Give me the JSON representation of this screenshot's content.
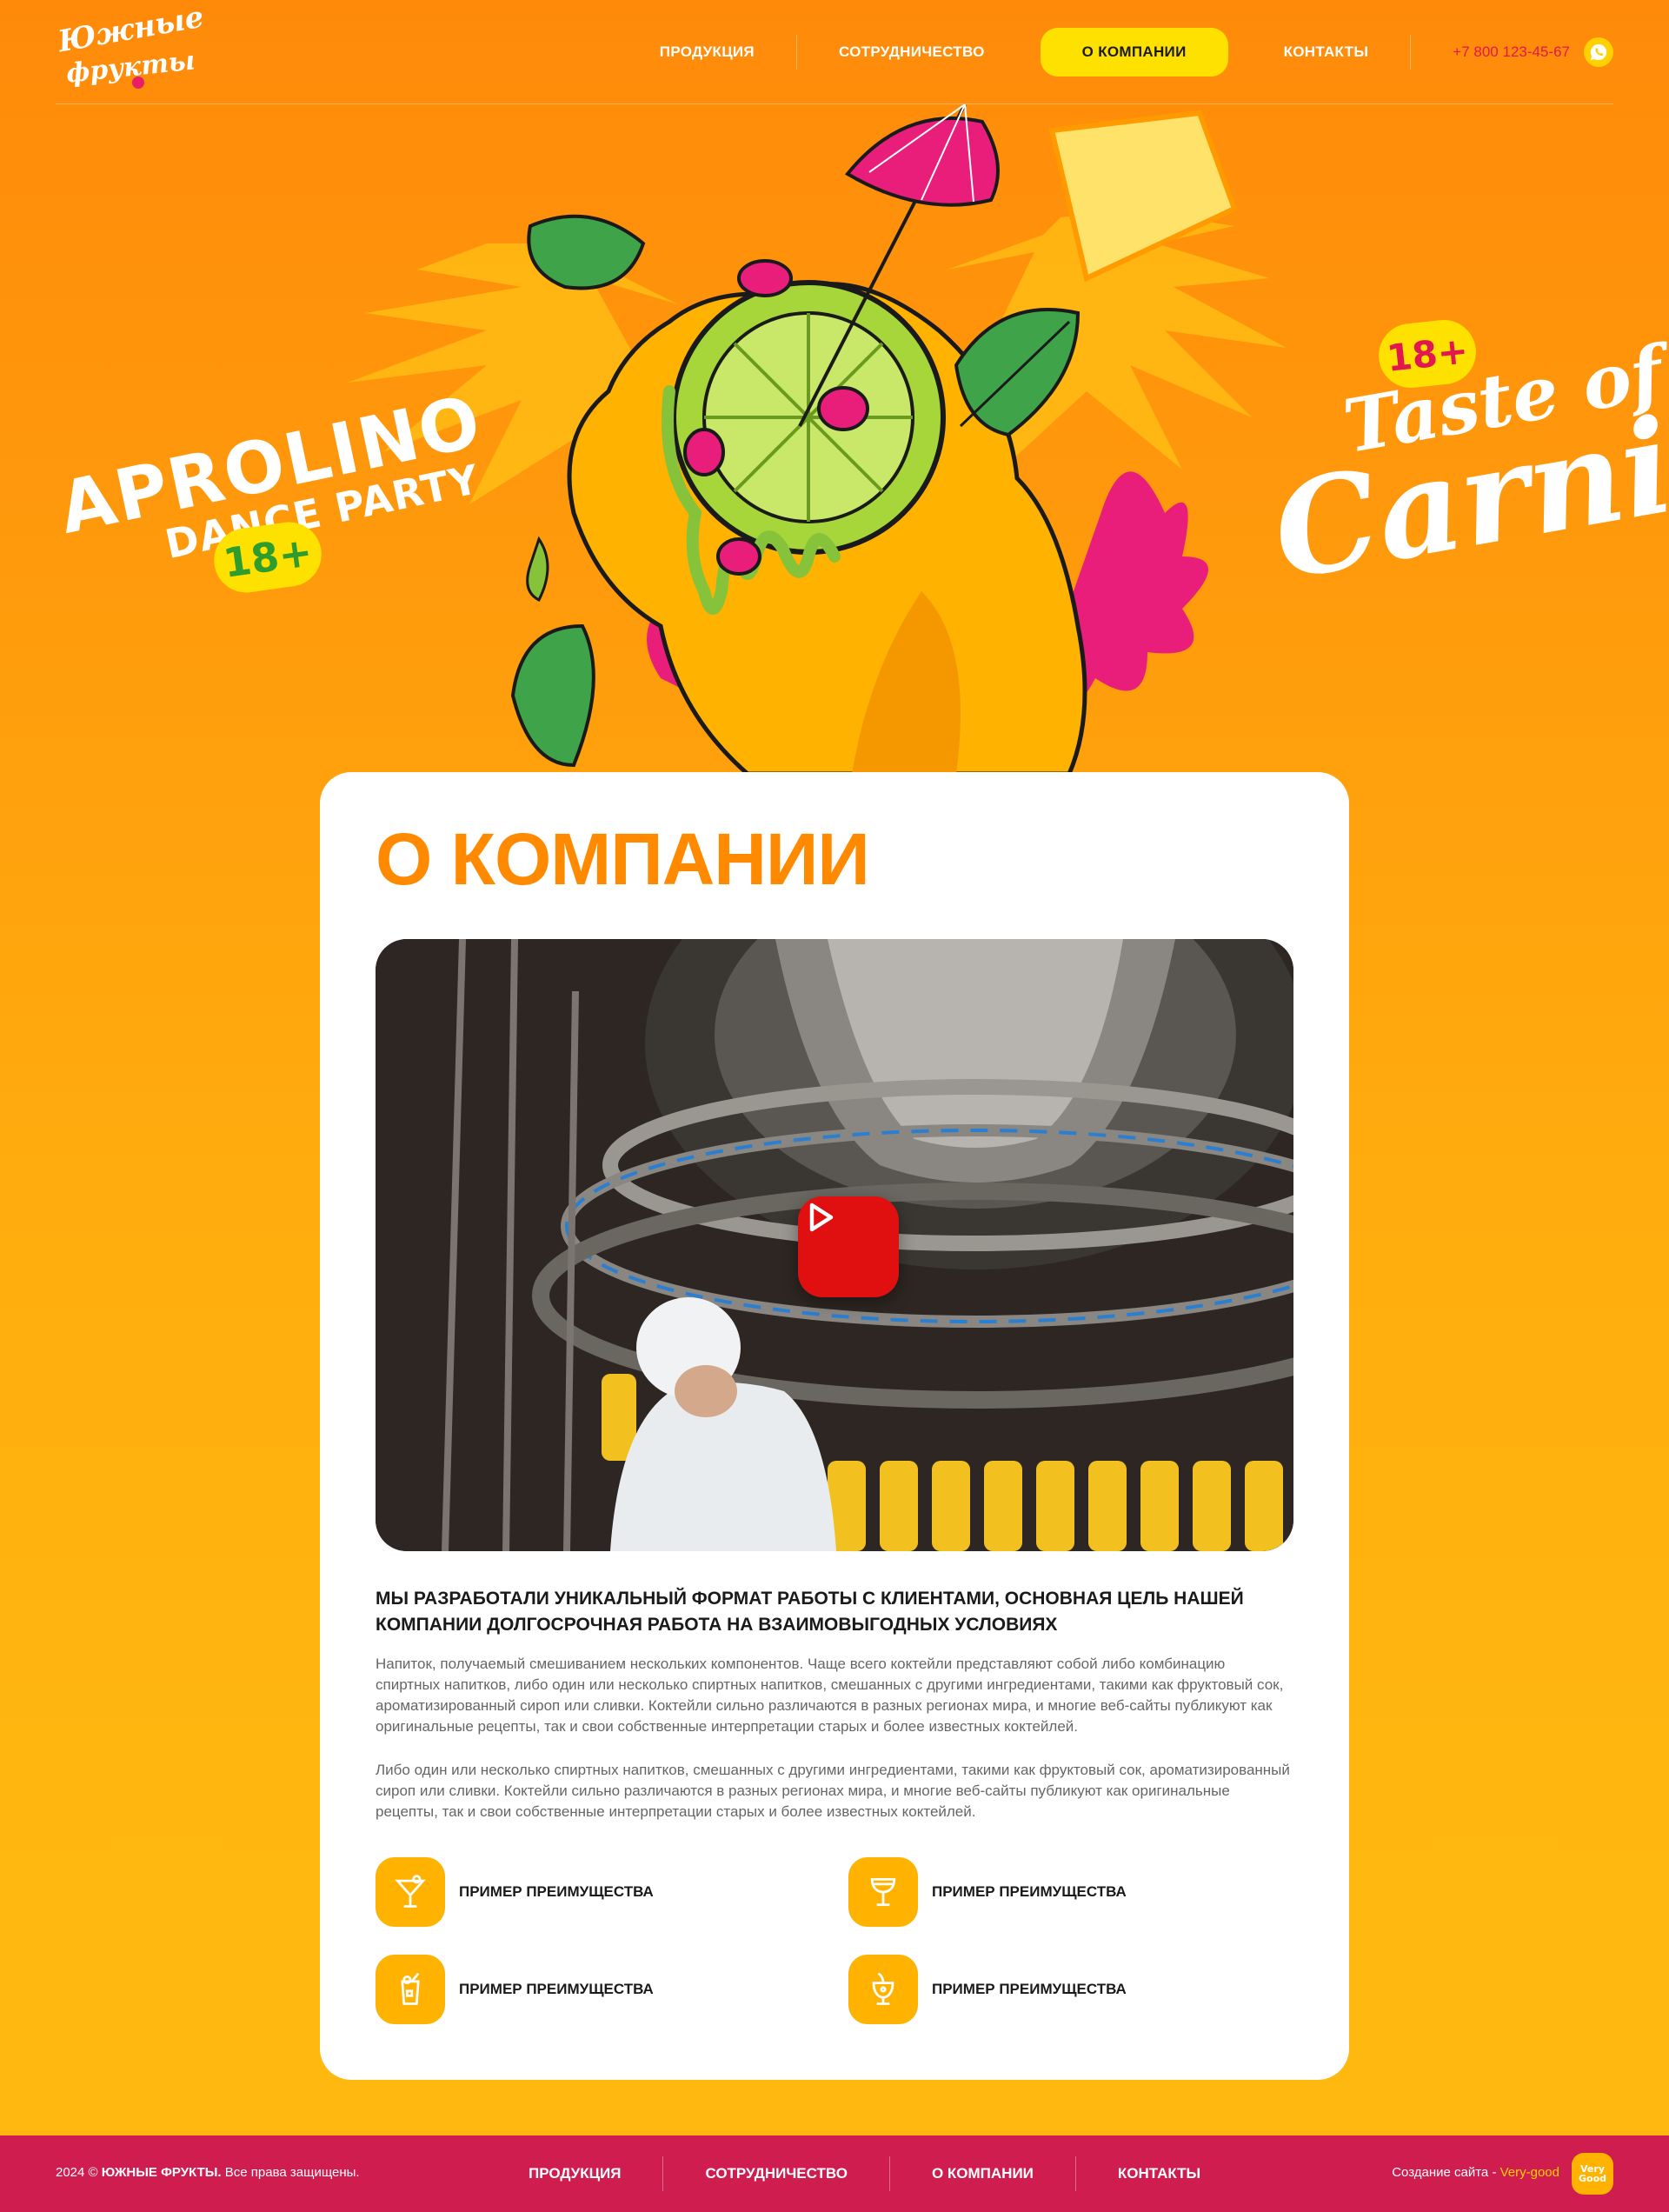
{
  "header": {
    "logo_line1": "Южные",
    "logo_line2": "фрукты",
    "nav": [
      "ПРОДУКЦИЯ",
      "СОТРУДНИЧЕСТВО",
      "О КОМПАНИИ",
      "КОНТАКТЫ"
    ],
    "active_nav": "О КОМПАНИИ",
    "phone": "+7 800 123-45-67",
    "whatsapp_icon": "whatsapp-icon"
  },
  "hero": {
    "left_title": "APROLINO",
    "left_subtitle": "DANCE PARTY",
    "left_badge": "18+",
    "right_badge": "18+",
    "right_line1": "Taste of",
    "right_line2": "Carnival"
  },
  "about": {
    "title": "О КОМПАНИИ",
    "video_play_icon": "play-icon",
    "lead": "МЫ РАЗРАБОТАЛИ УНИКАЛЬНЫЙ ФОРМАТ РАБОТЫ С КЛИЕНТАМИ, ОСНОВНАЯ ЦЕЛЬ НАШЕЙ КОМПАНИИ ДОЛГОСРОЧНАЯ РАБОТА НА ВЗАИМОВЫГОДНЫХ УСЛОВИЯХ",
    "paragraph1": "Напиток, получаемый смешиванием нескольких компонентов. Чаще всего коктейли представляют собой либо комбинацию спиртных напитков, либо один или несколько спиртных напитков, смешанных с другими ингредиентами, такими как фруктовый сок, ароматизированный сироп или сливки. Коктейли сильно различаются в разных регионах мира, и многие веб-сайты публикуют как оригинальные рецепты, так и свои собственные интерпретации старых и более известных коктейлей.",
    "paragraph2": "Либо один или несколько спиртных напитков, смешанных с другими ингредиентами, такими как фруктовый сок, ароматизированный сироп или сливки. Коктейли сильно различаются в разных регионах мира, и многие веб-сайты публикуют как оригинальные рецепты, так и свои собственные интерпретации старых и более известных коктейлей.",
    "features": [
      {
        "label": "ПРИМЕР ПРЕИМУЩЕСТВА",
        "icon": "martini-icon"
      },
      {
        "label": "ПРИМЕР ПРЕИМУЩЕСТВА",
        "icon": "coupe-glass-icon"
      },
      {
        "label": "ПРИМЕР ПРЕИМУЩЕСТВА",
        "icon": "highball-icon"
      },
      {
        "label": "ПРИМЕР ПРЕИМУЩЕСТВА",
        "icon": "tropical-drink-icon"
      }
    ]
  },
  "footer": {
    "copyright_year": "2024 ©",
    "copyright_brand": "ЮЖНЫЕ ФРУКТЫ.",
    "copyright_rest": "Все права защищены.",
    "nav": [
      "ПРОДУКЦИЯ",
      "СОТРУДНИЧЕСТВО",
      "О КОМПАНИИ",
      "КОНТАКТЫ"
    ],
    "made_by": "Создание сайта -",
    "made_by_link": "Very-good",
    "made_logo_line1": "Very",
    "made_logo_line2": "Good"
  },
  "colors": {
    "orange": "#ff8a00",
    "yellow": "#ffe100",
    "pink": "#cf1d4f",
    "amber": "#ffb300"
  }
}
